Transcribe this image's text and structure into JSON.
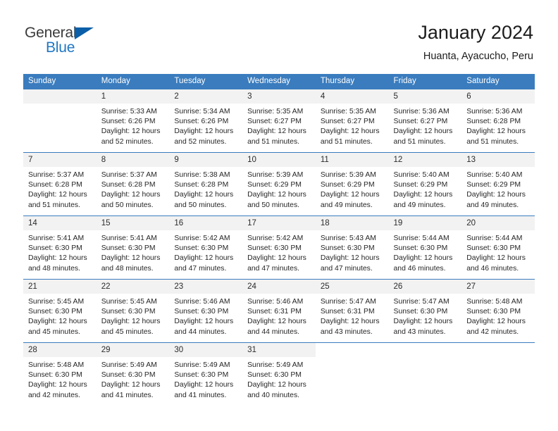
{
  "logo": {
    "word1": "General",
    "word2": "Blue",
    "triangle_color": "#0a5fa8",
    "blue_color": "#2077c4"
  },
  "header": {
    "title": "January 2024",
    "subtitle": "Huanta, Ayacucho, Peru",
    "accent_color": "#3a7cbe"
  },
  "weekdays": [
    "Sunday",
    "Monday",
    "Tuesday",
    "Wednesday",
    "Thursday",
    "Friday",
    "Saturday"
  ],
  "labels": {
    "sunrise": "Sunrise:",
    "sunset": "Sunset:",
    "daylight": "Daylight:"
  },
  "weeks": [
    [
      {
        "day": "",
        "sunrise": "",
        "sunset": "",
        "daylight1": "",
        "daylight2": ""
      },
      {
        "day": "1",
        "sunrise": "Sunrise: 5:33 AM",
        "sunset": "Sunset: 6:26 PM",
        "daylight1": "Daylight: 12 hours",
        "daylight2": "and 52 minutes."
      },
      {
        "day": "2",
        "sunrise": "Sunrise: 5:34 AM",
        "sunset": "Sunset: 6:26 PM",
        "daylight1": "Daylight: 12 hours",
        "daylight2": "and 52 minutes."
      },
      {
        "day": "3",
        "sunrise": "Sunrise: 5:35 AM",
        "sunset": "Sunset: 6:27 PM",
        "daylight1": "Daylight: 12 hours",
        "daylight2": "and 51 minutes."
      },
      {
        "day": "4",
        "sunrise": "Sunrise: 5:35 AM",
        "sunset": "Sunset: 6:27 PM",
        "daylight1": "Daylight: 12 hours",
        "daylight2": "and 51 minutes."
      },
      {
        "day": "5",
        "sunrise": "Sunrise: 5:36 AM",
        "sunset": "Sunset: 6:27 PM",
        "daylight1": "Daylight: 12 hours",
        "daylight2": "and 51 minutes."
      },
      {
        "day": "6",
        "sunrise": "Sunrise: 5:36 AM",
        "sunset": "Sunset: 6:28 PM",
        "daylight1": "Daylight: 12 hours",
        "daylight2": "and 51 minutes."
      }
    ],
    [
      {
        "day": "7",
        "sunrise": "Sunrise: 5:37 AM",
        "sunset": "Sunset: 6:28 PM",
        "daylight1": "Daylight: 12 hours",
        "daylight2": "and 51 minutes."
      },
      {
        "day": "8",
        "sunrise": "Sunrise: 5:37 AM",
        "sunset": "Sunset: 6:28 PM",
        "daylight1": "Daylight: 12 hours",
        "daylight2": "and 50 minutes."
      },
      {
        "day": "9",
        "sunrise": "Sunrise: 5:38 AM",
        "sunset": "Sunset: 6:28 PM",
        "daylight1": "Daylight: 12 hours",
        "daylight2": "and 50 minutes."
      },
      {
        "day": "10",
        "sunrise": "Sunrise: 5:39 AM",
        "sunset": "Sunset: 6:29 PM",
        "daylight1": "Daylight: 12 hours",
        "daylight2": "and 50 minutes."
      },
      {
        "day": "11",
        "sunrise": "Sunrise: 5:39 AM",
        "sunset": "Sunset: 6:29 PM",
        "daylight1": "Daylight: 12 hours",
        "daylight2": "and 49 minutes."
      },
      {
        "day": "12",
        "sunrise": "Sunrise: 5:40 AM",
        "sunset": "Sunset: 6:29 PM",
        "daylight1": "Daylight: 12 hours",
        "daylight2": "and 49 minutes."
      },
      {
        "day": "13",
        "sunrise": "Sunrise: 5:40 AM",
        "sunset": "Sunset: 6:29 PM",
        "daylight1": "Daylight: 12 hours",
        "daylight2": "and 49 minutes."
      }
    ],
    [
      {
        "day": "14",
        "sunrise": "Sunrise: 5:41 AM",
        "sunset": "Sunset: 6:30 PM",
        "daylight1": "Daylight: 12 hours",
        "daylight2": "and 48 minutes."
      },
      {
        "day": "15",
        "sunrise": "Sunrise: 5:41 AM",
        "sunset": "Sunset: 6:30 PM",
        "daylight1": "Daylight: 12 hours",
        "daylight2": "and 48 minutes."
      },
      {
        "day": "16",
        "sunrise": "Sunrise: 5:42 AM",
        "sunset": "Sunset: 6:30 PM",
        "daylight1": "Daylight: 12 hours",
        "daylight2": "and 47 minutes."
      },
      {
        "day": "17",
        "sunrise": "Sunrise: 5:42 AM",
        "sunset": "Sunset: 6:30 PM",
        "daylight1": "Daylight: 12 hours",
        "daylight2": "and 47 minutes."
      },
      {
        "day": "18",
        "sunrise": "Sunrise: 5:43 AM",
        "sunset": "Sunset: 6:30 PM",
        "daylight1": "Daylight: 12 hours",
        "daylight2": "and 47 minutes."
      },
      {
        "day": "19",
        "sunrise": "Sunrise: 5:44 AM",
        "sunset": "Sunset: 6:30 PM",
        "daylight1": "Daylight: 12 hours",
        "daylight2": "and 46 minutes."
      },
      {
        "day": "20",
        "sunrise": "Sunrise: 5:44 AM",
        "sunset": "Sunset: 6:30 PM",
        "daylight1": "Daylight: 12 hours",
        "daylight2": "and 46 minutes."
      }
    ],
    [
      {
        "day": "21",
        "sunrise": "Sunrise: 5:45 AM",
        "sunset": "Sunset: 6:30 PM",
        "daylight1": "Daylight: 12 hours",
        "daylight2": "and 45 minutes."
      },
      {
        "day": "22",
        "sunrise": "Sunrise: 5:45 AM",
        "sunset": "Sunset: 6:30 PM",
        "daylight1": "Daylight: 12 hours",
        "daylight2": "and 45 minutes."
      },
      {
        "day": "23",
        "sunrise": "Sunrise: 5:46 AM",
        "sunset": "Sunset: 6:30 PM",
        "daylight1": "Daylight: 12 hours",
        "daylight2": "and 44 minutes."
      },
      {
        "day": "24",
        "sunrise": "Sunrise: 5:46 AM",
        "sunset": "Sunset: 6:31 PM",
        "daylight1": "Daylight: 12 hours",
        "daylight2": "and 44 minutes."
      },
      {
        "day": "25",
        "sunrise": "Sunrise: 5:47 AM",
        "sunset": "Sunset: 6:31 PM",
        "daylight1": "Daylight: 12 hours",
        "daylight2": "and 43 minutes."
      },
      {
        "day": "26",
        "sunrise": "Sunrise: 5:47 AM",
        "sunset": "Sunset: 6:30 PM",
        "daylight1": "Daylight: 12 hours",
        "daylight2": "and 43 minutes."
      },
      {
        "day": "27",
        "sunrise": "Sunrise: 5:48 AM",
        "sunset": "Sunset: 6:30 PM",
        "daylight1": "Daylight: 12 hours",
        "daylight2": "and 42 minutes."
      }
    ],
    [
      {
        "day": "28",
        "sunrise": "Sunrise: 5:48 AM",
        "sunset": "Sunset: 6:30 PM",
        "daylight1": "Daylight: 12 hours",
        "daylight2": "and 42 minutes."
      },
      {
        "day": "29",
        "sunrise": "Sunrise: 5:49 AM",
        "sunset": "Sunset: 6:30 PM",
        "daylight1": "Daylight: 12 hours",
        "daylight2": "and 41 minutes."
      },
      {
        "day": "30",
        "sunrise": "Sunrise: 5:49 AM",
        "sunset": "Sunset: 6:30 PM",
        "daylight1": "Daylight: 12 hours",
        "daylight2": "and 41 minutes."
      },
      {
        "day": "31",
        "sunrise": "Sunrise: 5:49 AM",
        "sunset": "Sunset: 6:30 PM",
        "daylight1": "Daylight: 12 hours",
        "daylight2": "and 40 minutes."
      },
      {
        "day": "",
        "sunrise": "",
        "sunset": "",
        "daylight1": "",
        "daylight2": ""
      },
      {
        "day": "",
        "sunrise": "",
        "sunset": "",
        "daylight1": "",
        "daylight2": ""
      },
      {
        "day": "",
        "sunrise": "",
        "sunset": "",
        "daylight1": "",
        "daylight2": ""
      }
    ]
  ]
}
